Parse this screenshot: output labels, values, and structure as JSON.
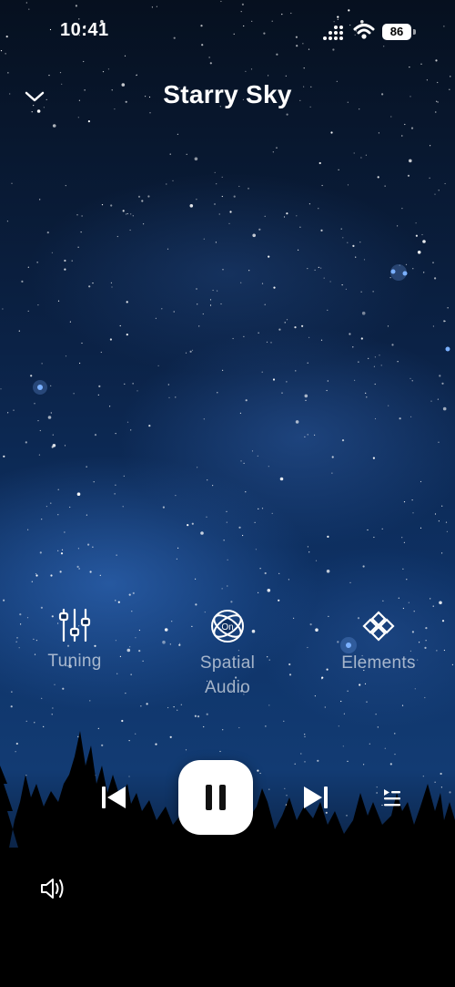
{
  "status_bar": {
    "time": "10:41",
    "battery": "86"
  },
  "header": {
    "title": "Starry Sky"
  },
  "features": [
    {
      "label": "Tuning",
      "icon": "sliders-icon"
    },
    {
      "label": "Spatial Audio",
      "icon": "spatial-audio-icon",
      "badge": "On"
    },
    {
      "label": "Elements",
      "icon": "elements-icon"
    }
  ],
  "controls": {
    "previous_icon": "skip-previous-icon",
    "play_state": "playing",
    "pause_icon": "pause-icon",
    "next_icon": "skip-next-icon",
    "queue_icon": "queue-icon",
    "volume_icon": "volume-icon"
  },
  "colors": {
    "sky_top": "#081327",
    "sky_mid": "#0f3a74",
    "glow": "#2a5fb8",
    "button": "#ffffff"
  }
}
